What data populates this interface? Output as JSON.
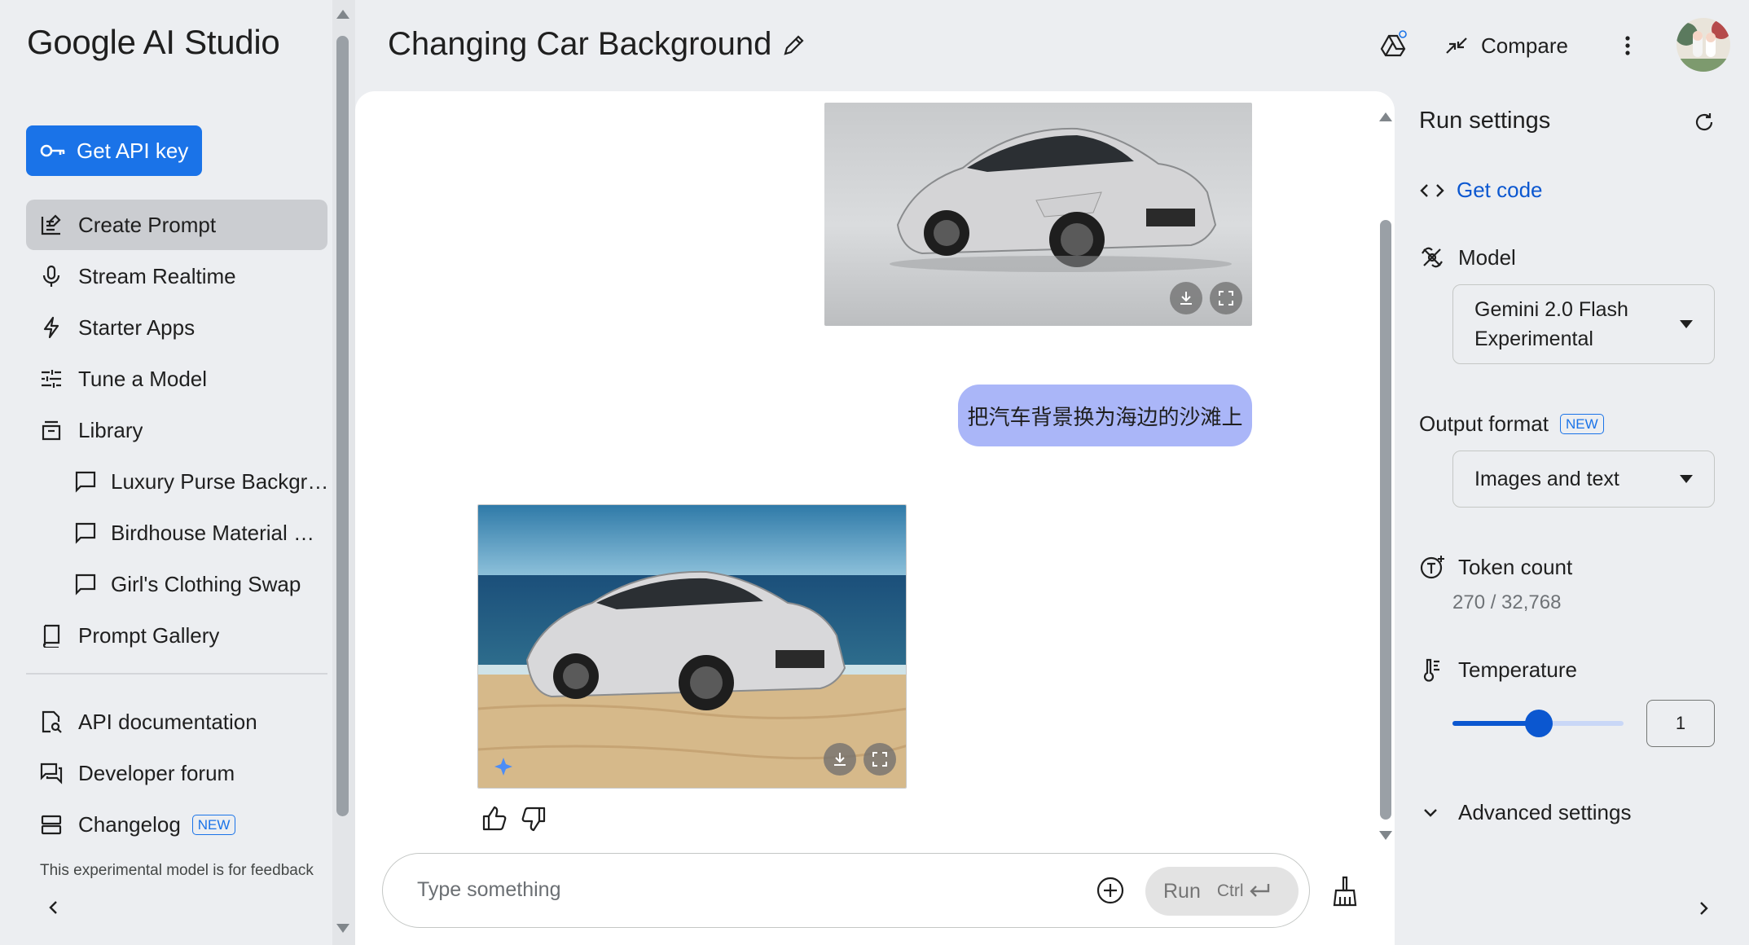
{
  "app": {
    "brand": "Google AI Studio"
  },
  "sidebar": {
    "api_key_label": "Get API key",
    "items": [
      {
        "label": "Create Prompt",
        "icon": "create-prompt-icon"
      },
      {
        "label": "Stream Realtime",
        "icon": "mic-icon"
      },
      {
        "label": "Starter Apps",
        "icon": "bolt-icon"
      },
      {
        "label": "Tune a Model",
        "icon": "tune-icon"
      },
      {
        "label": "Library",
        "icon": "library-icon"
      }
    ],
    "library": [
      {
        "label": "Luxury Purse Backgro..."
      },
      {
        "label": "Birdhouse Material Ch..."
      },
      {
        "label": "Girl's Clothing Swap"
      }
    ],
    "gallery_label": "Prompt Gallery",
    "bottom": [
      {
        "label": "API documentation"
      },
      {
        "label": "Developer forum"
      },
      {
        "label": "Changelog",
        "badge": "NEW"
      }
    ],
    "footer_note": "This experimental model is for feedback"
  },
  "header": {
    "title": "Changing Car Background",
    "compare_label": "Compare"
  },
  "chat": {
    "user_message": "把汽车背景换为海边的沙滩上",
    "input_placeholder": "Type something",
    "run_label": "Run",
    "run_shortcut": "Ctrl"
  },
  "run_settings": {
    "title": "Run settings",
    "get_code_label": "Get code",
    "model_label": "Model",
    "model_value_line1": "Gemini 2.0 Flash",
    "model_value_line2": "Experimental",
    "output_format_label": "Output format",
    "output_format_badge": "NEW",
    "output_format_value": "Images and text",
    "token_count_label": "Token count",
    "token_count_value": "270 / 32,768",
    "temperature_label": "Temperature",
    "temperature_value": "1",
    "temperature_fraction": 0.5,
    "advanced_label": "Advanced settings"
  },
  "colors": {
    "accent": "#1a73e8",
    "link": "#0b57d0",
    "bubble": "#aab6f8",
    "background": "#eceef1"
  }
}
